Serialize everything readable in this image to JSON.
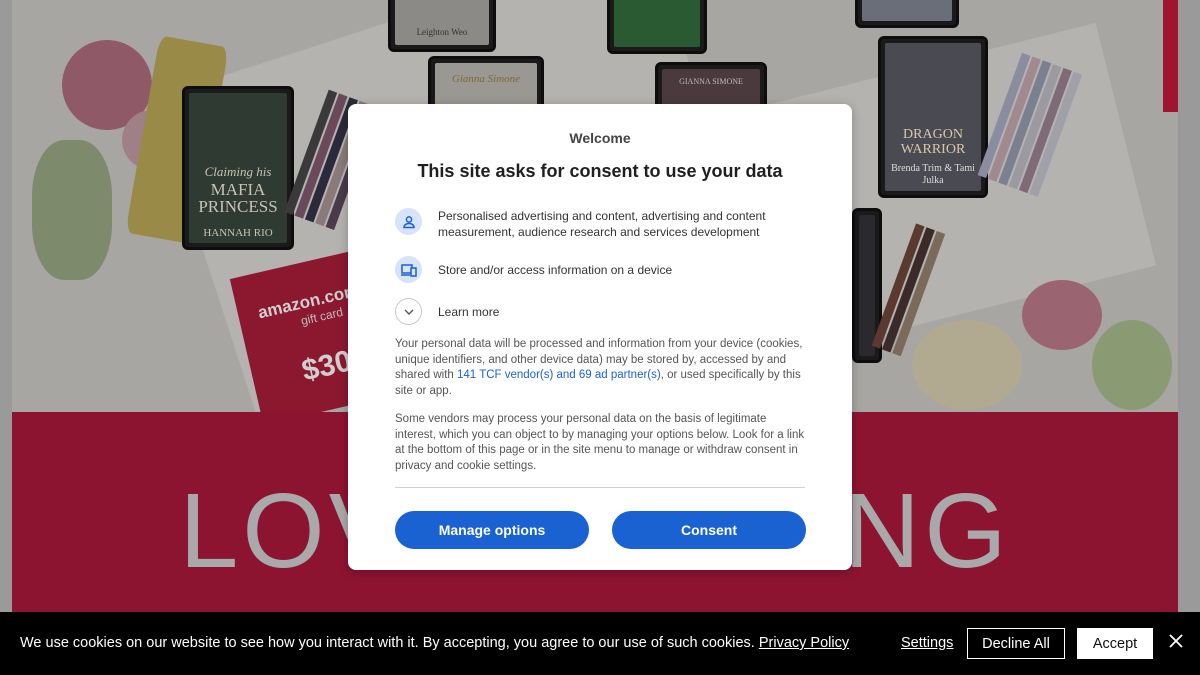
{
  "background": {
    "headline": "LOVE GETTING",
    "books": [
      {
        "title": "Claiming his",
        "subtitle": "MAFIA PRINCESS",
        "author": "HANNAH RIO"
      },
      {
        "title": "DRAGON WARRIOR",
        "author": "Brenda Trim & Tami Julka"
      },
      {
        "author": "Leighton Weo"
      },
      {
        "author": "Gianna Simone"
      },
      {
        "author": "GIANNA SIMONE"
      }
    ],
    "gift_card": {
      "brand": "amazon.com",
      "type": "gift card",
      "amount": "$30"
    }
  },
  "consent_dialog": {
    "welcome": "Welcome",
    "title": "This site asks for consent to use your data",
    "purposes": [
      {
        "icon": "person-icon",
        "text": "Personalised advertising and content, advertising and content measurement, audience research and services development"
      },
      {
        "icon": "devices-icon",
        "text": "Store and/or access information on a device"
      }
    ],
    "learn_more": "Learn more",
    "para1_before": "Your personal data will be processed and information from your device (cookies, unique identifiers, and other device data) may be stored by, accessed by and shared with ",
    "para1_link": "141 TCF vendor(s) and 69 ad partner(s)",
    "para1_after": ", or used specifically by this site or app.",
    "para2": "Some vendors may process your personal data on the basis of legitimate interest, which you can object to by managing your options below. Look for a link at the bottom of this page or in the site menu to manage or withdraw consent in privacy and cookie settings.",
    "manage_options": "Manage options",
    "consent": "Consent",
    "accent_color": "#1a62d2"
  },
  "cookie_bar": {
    "text": "We use cookies on our website to see how you interact with it. By accepting, you agree to our use of such cookies.",
    "privacy_policy": "Privacy Policy",
    "settings": "Settings",
    "decline_all": "Decline All",
    "accept": "Accept",
    "close_icon": "close-icon"
  }
}
